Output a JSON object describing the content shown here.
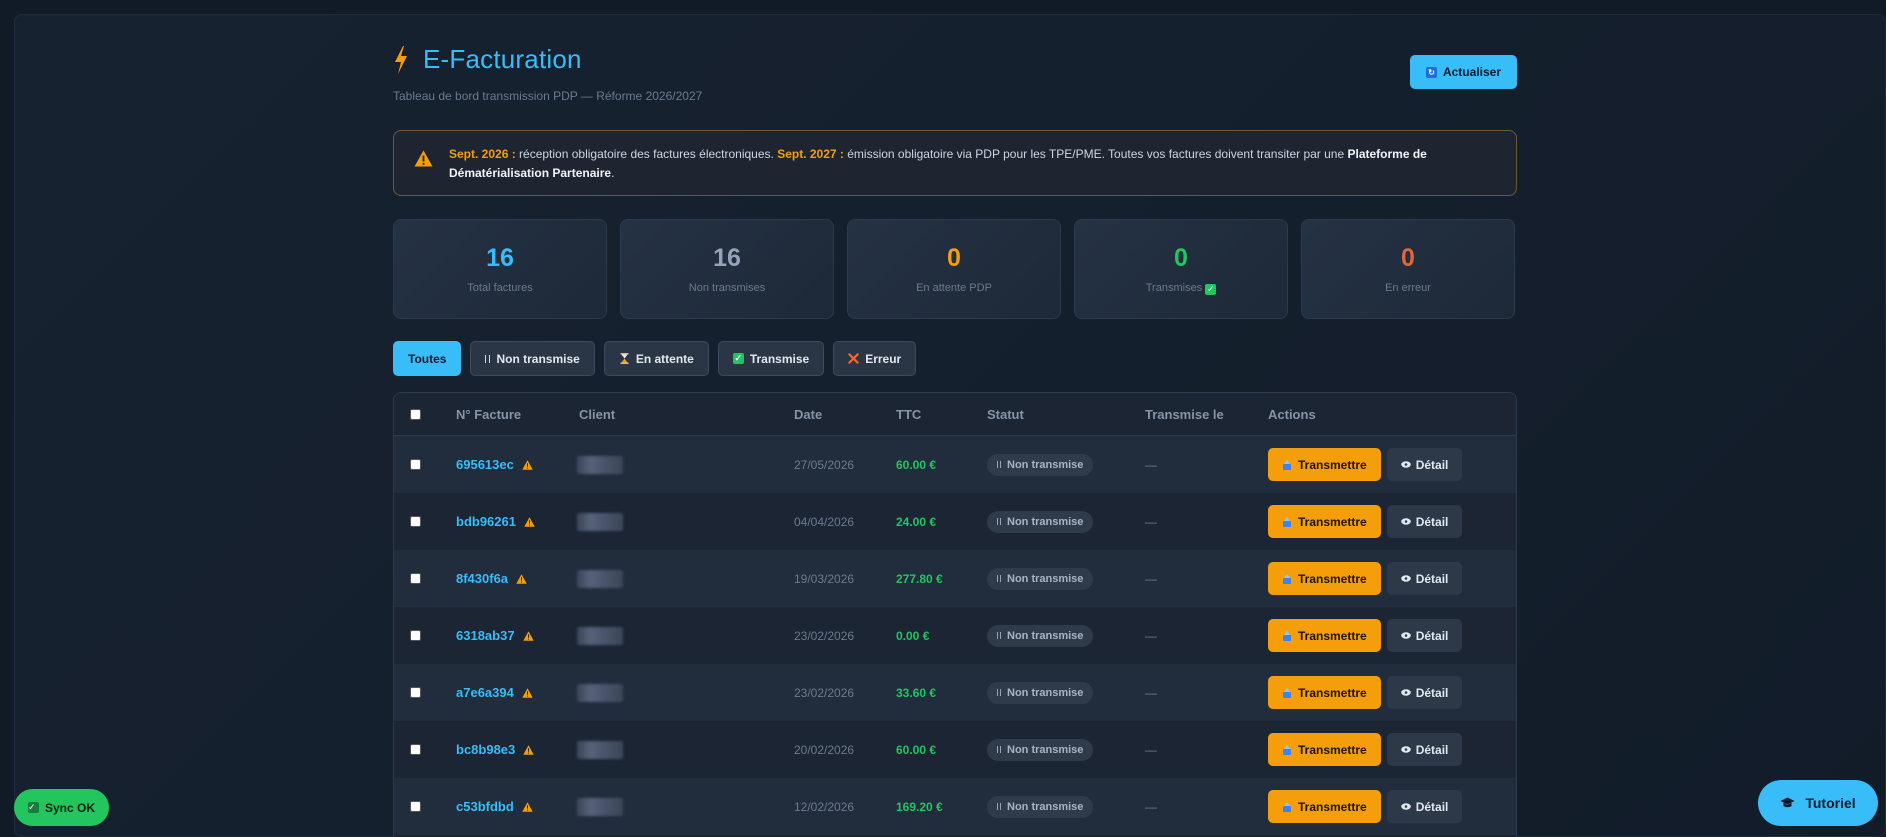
{
  "header": {
    "title": "E-Facturation",
    "subtitle": "Tableau de bord transmission PDP — Réforme 2026/2027",
    "refresh_label": "Actualiser"
  },
  "alert": {
    "date1": "Sept. 2026 :",
    "text1": " réception obligatoire des factures électroniques. ",
    "date2": "Sept. 2027 :",
    "text2": " émission obligatoire via PDP pour les TPE/PME. Toutes vos factures doivent transiter par une ",
    "bold": "Plateforme de Dématérialisation Partenaire",
    "end": "."
  },
  "stats": [
    {
      "value": "16",
      "label": "Total factures",
      "color": "#38bdf8"
    },
    {
      "value": "16",
      "label": "Non transmises",
      "color": "#94a3b8"
    },
    {
      "value": "0",
      "label": "En attente PDP",
      "color": "#f59e0b"
    },
    {
      "value": "0",
      "label": "Transmises",
      "color": "#22c55e"
    },
    {
      "value": "0",
      "label": "En erreur",
      "color": "#e0663a"
    }
  ],
  "filters": [
    "Toutes",
    "Non transmise",
    "En attente",
    "Transmise",
    "Erreur"
  ],
  "table": {
    "headers": [
      "N° Facture",
      "Client",
      "Date",
      "TTC",
      "Statut",
      "Transmise le",
      "Actions"
    ],
    "rows": [
      {
        "num": "695613ec",
        "date": "27/05/2026",
        "ttc": "60.00 €",
        "status": "Non transmise",
        "sent": "—"
      },
      {
        "num": "bdb96261",
        "date": "04/04/2026",
        "ttc": "24.00 €",
        "status": "Non transmise",
        "sent": "—"
      },
      {
        "num": "8f430f6a",
        "date": "19/03/2026",
        "ttc": "277.80 €",
        "status": "Non transmise",
        "sent": "—"
      },
      {
        "num": "6318ab37",
        "date": "23/02/2026",
        "ttc": "0.00 €",
        "status": "Non transmise",
        "sent": "—"
      },
      {
        "num": "a7e6a394",
        "date": "23/02/2026",
        "ttc": "33.60 €",
        "status": "Non transmise",
        "sent": "—"
      },
      {
        "num": "bc8b98e3",
        "date": "20/02/2026",
        "ttc": "60.00 €",
        "status": "Non transmise",
        "sent": "—"
      },
      {
        "num": "c53bfdbd",
        "date": "12/02/2026",
        "ttc": "169.20 €",
        "status": "Non transmise",
        "sent": "—"
      }
    ],
    "transmit_label": "Transmettre",
    "detail_label": "Détail"
  },
  "sync_label": "Sync OK",
  "tutorial_label": "Tutoriel"
}
